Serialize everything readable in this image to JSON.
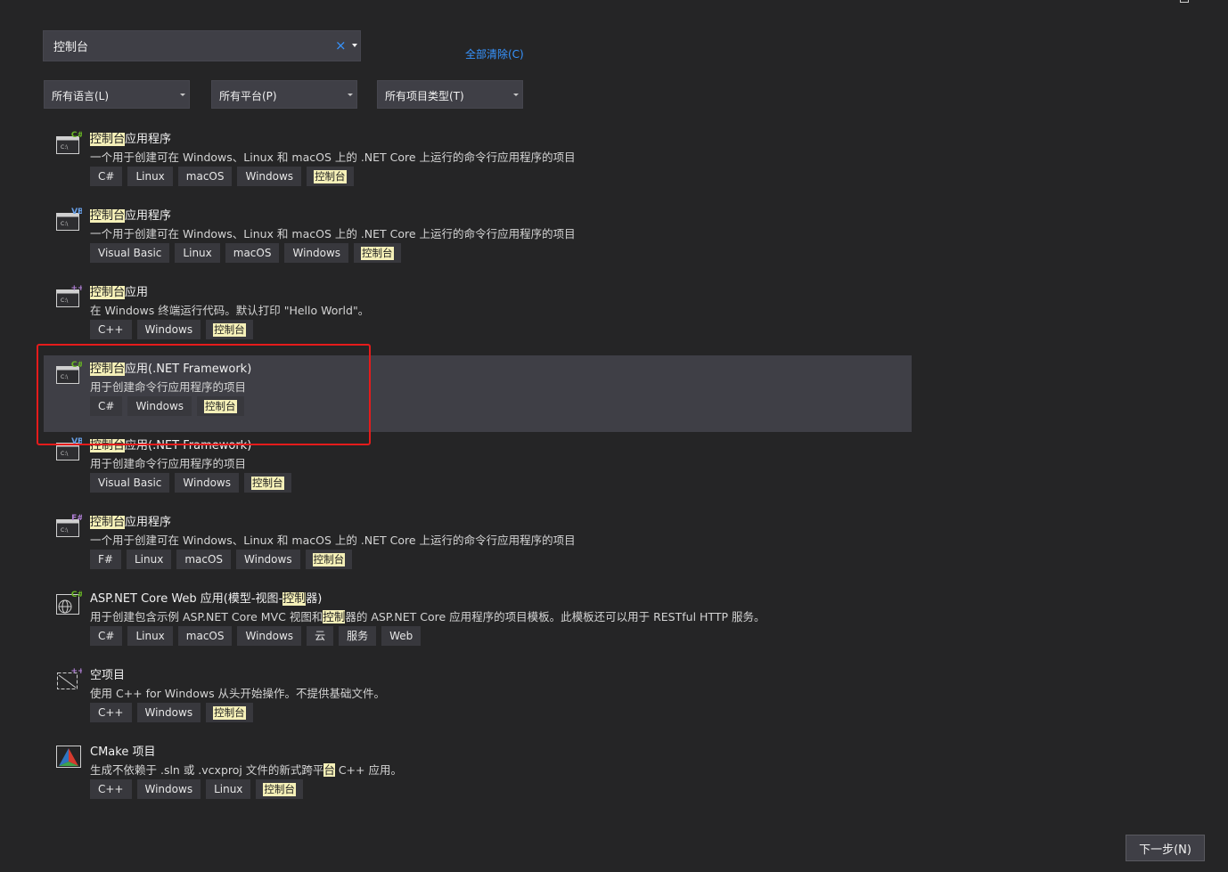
{
  "search": {
    "value": "控制台",
    "clear_icon": "×"
  },
  "clear_all_label": "全部清除(C)",
  "filters": [
    {
      "label": "所有语言(L)"
    },
    {
      "label": "所有平台(P)"
    },
    {
      "label": "所有项目类型(T)"
    }
  ],
  "highlight_color": "#f5f0b8",
  "templates": [
    {
      "title_hl": "控制台",
      "title_rest": "应用程序",
      "desc": "一个用于创建可在 Windows、Linux 和 macOS 上的 .NET Core 上运行的命令行应用程序的项目",
      "badge": "C#",
      "badge_color": "#68b723",
      "tags": [
        "C#",
        "Linux",
        "macOS",
        "Windows"
      ],
      "tag_hl": "控制台"
    },
    {
      "title_hl": "控制台",
      "title_rest": "应用程序",
      "desc": "一个用于创建可在 Windows、Linux 和 macOS 上的 .NET Core 上运行的命令行应用程序的项目",
      "badge": "VB",
      "badge_color": "#68a0e8",
      "tags": [
        "Visual Basic",
        "Linux",
        "macOS",
        "Windows"
      ],
      "tag_hl": "控制台"
    },
    {
      "title_hl": "控制台",
      "title_rest": "应用",
      "desc": "在 Windows 终端运行代码。默认打印 \"Hello World\"。",
      "badge": "++",
      "badge_color": "#b180d7",
      "tags": [
        "C++",
        "Windows"
      ],
      "tag_hl": "控制台"
    },
    {
      "title_hl": "控制台",
      "title_rest": "应用(.NET Framework)",
      "desc": "用于创建命令行应用程序的项目",
      "badge": "C#",
      "badge_color": "#68b723",
      "tags": [
        "C#",
        "Windows"
      ],
      "tag_hl": "控制台"
    },
    {
      "title_hl": "控制台",
      "title_rest": "应用(.NET Framework)",
      "desc": "用于创建命令行应用程序的项目",
      "badge": "VB",
      "badge_color": "#68a0e8",
      "tags": [
        "Visual Basic",
        "Windows"
      ],
      "tag_hl": "控制台"
    },
    {
      "title_hl": "控制台",
      "title_rest": "应用程序",
      "desc": "一个用于创建可在 Windows、Linux 和 macOS 上的 .NET Core 上运行的命令行应用程序的项目",
      "badge": "F#",
      "badge_color": "#b180d7",
      "tags": [
        "F#",
        "Linux",
        "macOS",
        "Windows"
      ],
      "tag_hl": "控制台"
    },
    {
      "title_pre": "ASP.NET Core Web 应用(模型-视图-",
      "title_hl": "控制",
      "title_rest": "器)",
      "desc_pre": "用于创建包含示例 ASP.NET Core MVC 视图和",
      "desc_hl": "控制",
      "desc_rest": "器的 ASP.NET Core 应用程序的项目模板。此模板还可以用于 RESTful HTTP 服务。",
      "badge": "C#",
      "badge_color": "#68b723",
      "tags": [
        "C#",
        "Linux",
        "macOS",
        "Windows",
        "云",
        "服务",
        "Web"
      ]
    },
    {
      "title_rest": "空项目",
      "desc": "使用 C++ for Windows 从头开始操作。不提供基础文件。",
      "badge": "++",
      "badge_color": "#b180d7",
      "tags": [
        "C++",
        "Windows"
      ],
      "tag_hl": "控制台"
    },
    {
      "title_rest": "CMake 项目",
      "desc_pre": "生成不依赖于 .sln 或 .vcxproj 文件的新式跨平",
      "desc_hl": "台",
      "desc_rest": " C++ 应用。",
      "tags": [
        "C++",
        "Windows",
        "Linux"
      ],
      "tag_hl": "控制台"
    }
  ],
  "next_button_label": "下一步(N)"
}
